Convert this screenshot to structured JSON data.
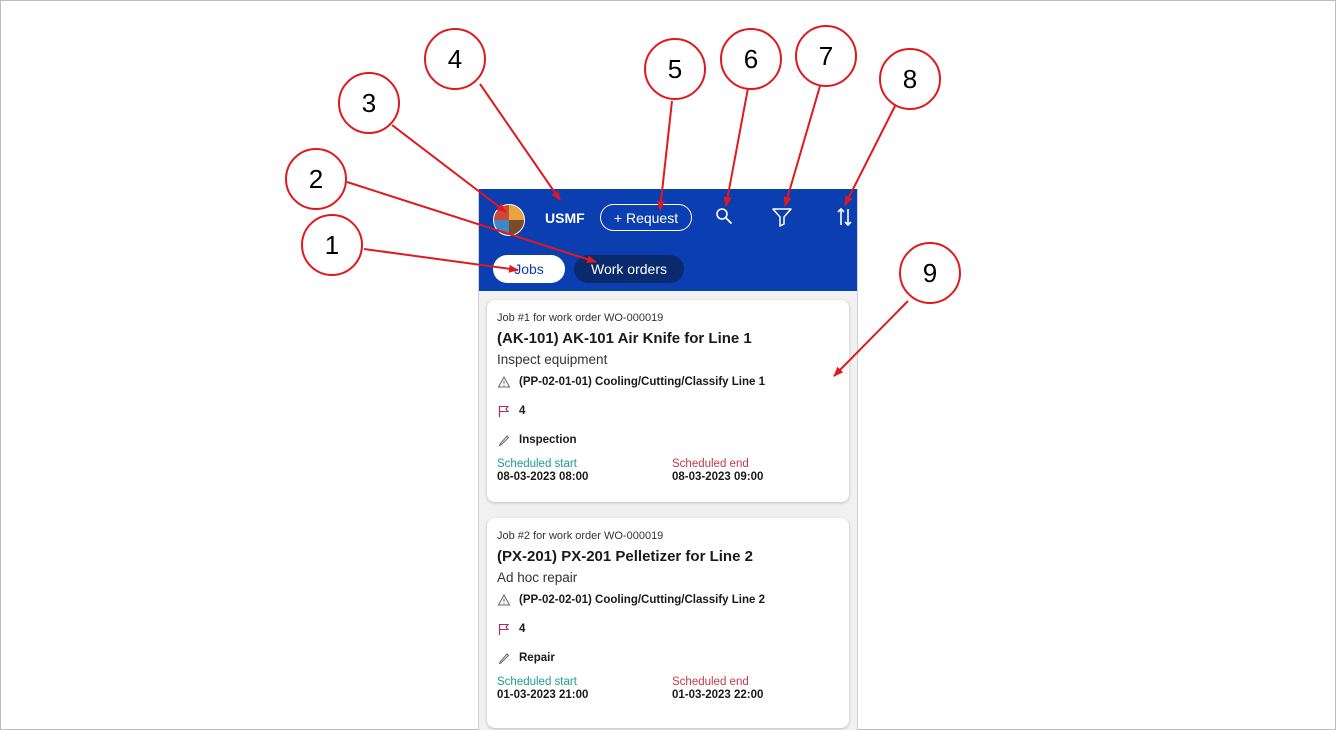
{
  "header": {
    "company": "USMF",
    "request_label": "+ Request"
  },
  "tabs": [
    {
      "label": "Jobs",
      "selected": true
    },
    {
      "label": "Work orders",
      "selected": false
    }
  ],
  "jobs": [
    {
      "caption": "Job #1 for work order WO-000019",
      "asset": "(AK-101) AK-101 Air Knife for Line 1",
      "job_type": "Inspect equipment",
      "functional_location": "(PP-02-01-01) Cooling/Cutting/Classify Line 1",
      "priority": "4",
      "category": "Inspection",
      "scheduled_start_label": "Scheduled start",
      "scheduled_start": "08-03-2023 08:00",
      "scheduled_end_label": "Scheduled end",
      "scheduled_end": "08-03-2023 09:00"
    },
    {
      "caption": "Job #2 for work order WO-000019",
      "asset": "(PX-201) PX-201 Pelletizer for Line 2",
      "job_type": "Ad hoc repair",
      "functional_location": "(PP-02-02-01) Cooling/Cutting/Classify Line 2",
      "priority": "4",
      "category": "Repair",
      "scheduled_start_label": "Scheduled start",
      "scheduled_start": "01-03-2023 21:00",
      "scheduled_end_label": "Scheduled end",
      "scheduled_end": "01-03-2023 22:00"
    }
  ],
  "callouts": [
    "1",
    "2",
    "3",
    "4",
    "5",
    "6",
    "7",
    "8",
    "9"
  ],
  "colors": {
    "header_bg": "#0b3eb0",
    "callout_red": "#e0191f",
    "scheduled_start": "#1b9e8a",
    "scheduled_end": "#c7384a"
  },
  "icons": [
    "avatar",
    "search-icon",
    "filter-icon",
    "sort-icon",
    "warning-icon",
    "flag-icon",
    "pencil-icon"
  ]
}
